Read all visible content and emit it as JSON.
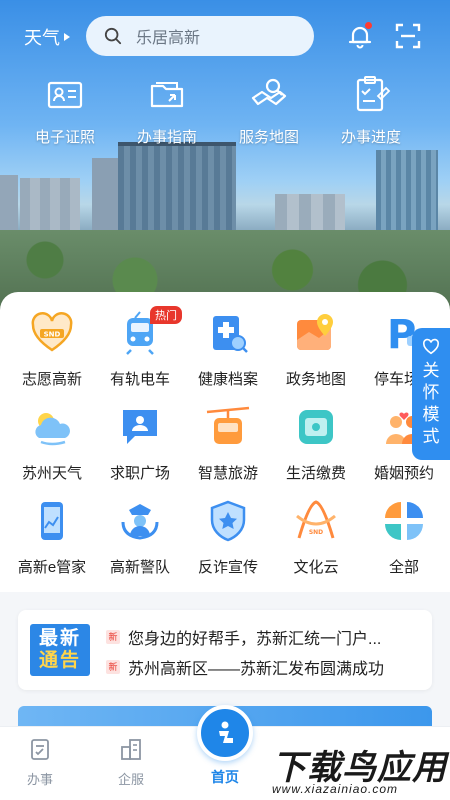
{
  "header": {
    "city": "天气",
    "search_placeholder": "乐居高新"
  },
  "quick_actions": [
    {
      "label": "电子证照",
      "icon": "id-card-icon"
    },
    {
      "label": "办事指南",
      "icon": "guide-folder-icon"
    },
    {
      "label": "服务地图",
      "icon": "map-search-icon"
    },
    {
      "label": "办事进度",
      "icon": "progress-clipboard-icon"
    }
  ],
  "services": [
    {
      "label": "志愿高新",
      "icon": "volunteer-heart-icon"
    },
    {
      "label": "有轨电车",
      "icon": "tram-icon",
      "badge": "热门"
    },
    {
      "label": "健康档案",
      "icon": "health-record-icon"
    },
    {
      "label": "政务地图",
      "icon": "gov-map-icon"
    },
    {
      "label": "停车场查",
      "icon": "parking-icon"
    },
    {
      "label": "苏州天气",
      "icon": "weather-cloud-icon"
    },
    {
      "label": "求职广场",
      "icon": "job-chat-icon"
    },
    {
      "label": "智慧旅游",
      "icon": "cable-car-icon"
    },
    {
      "label": "生活缴费",
      "icon": "bill-payment-icon"
    },
    {
      "label": "婚姻预约",
      "icon": "marriage-icon"
    },
    {
      "label": "高新e管家",
      "icon": "phone-manager-icon"
    },
    {
      "label": "高新警队",
      "icon": "police-icon"
    },
    {
      "label": "反诈宣传",
      "icon": "anti-fraud-shield-icon"
    },
    {
      "label": "文化云",
      "icon": "culture-cloud-icon"
    },
    {
      "label": "全部",
      "icon": "all-apps-icon"
    }
  ],
  "care_mode": {
    "label": "关怀模式"
  },
  "notice": {
    "badge_line1": "最新",
    "badge_line2": "通告",
    "tag": "新",
    "items": [
      "您身边的好帮手，苏新汇统一门户...",
      "苏州高新区——苏新汇发布圆满成功"
    ]
  },
  "bottom_nav": [
    {
      "label": "办事",
      "icon": "tasks-icon"
    },
    {
      "label": "企服",
      "icon": "enterprise-icon"
    },
    {
      "label": "首页",
      "icon": "home-icon"
    }
  ],
  "watermark": {
    "title": "下载鸟应用",
    "url": "www.xiazainiao.com"
  },
  "colors": {
    "primary": "#2f8ef0",
    "hot": "#e8372c"
  }
}
